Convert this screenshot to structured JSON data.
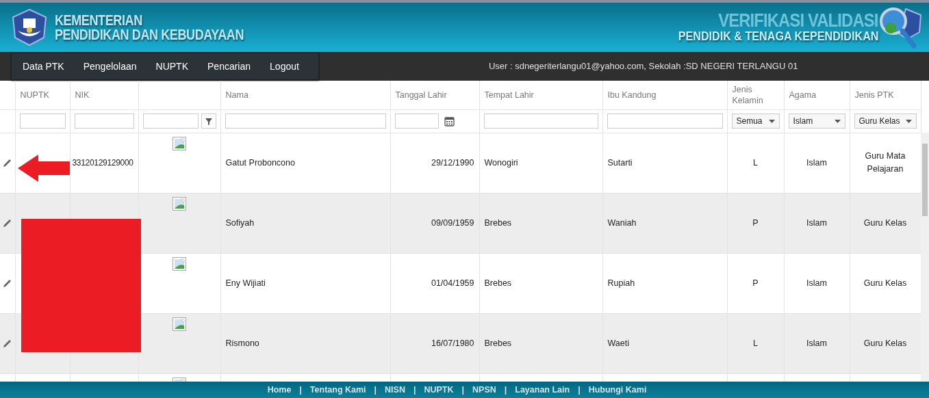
{
  "header": {
    "title_lines": [
      "KEMENTERIAN",
      "PENDIDIKAN DAN KEBUDAYAAN"
    ],
    "app_title": "VERIFIKASI VALIDASI",
    "app_subtitle": "PENDIDIK & TENAGA KEPENDIDIKAN"
  },
  "menu": [
    "Data PTK",
    "Pengelolaan",
    "NUPTK",
    "Pencarian",
    "Logout"
  ],
  "user_info": "User : sdnegeriterlangu01@yahoo.com, Sekolah :SD NEGERI TERLANGU 01",
  "table": {
    "columns": [
      {
        "label": "NUPTK",
        "filter": {
          "kind": "text"
        }
      },
      {
        "label": "NIK",
        "filter": {
          "kind": "text"
        }
      },
      {
        "filter": {
          "kind": "funnel"
        }
      },
      {
        "label": "Nama",
        "filter": {
          "kind": "text"
        }
      },
      {
        "label": "Tanggal Lahir",
        "filter": {
          "kind": "date"
        }
      },
      {
        "label": "Tempat Lahir",
        "filter": {
          "kind": "text"
        }
      },
      {
        "label": "Ibu Kandung",
        "filter": {
          "kind": "text"
        }
      },
      {
        "label": "Jenis Kelamin",
        "filter": {
          "kind": "select",
          "value": "Semua"
        }
      },
      {
        "label": "Agama",
        "filter": {
          "kind": "select",
          "value": "Islam"
        }
      },
      {
        "label": "Jenis PTK",
        "filter": {
          "kind": "select",
          "value": "Guru Kelas"
        }
      }
    ],
    "rows": [
      {
        "nik": "33120129129000",
        "nama": "Gatut Proboncono",
        "tanggal_lahir": "29/12/1990",
        "tempat_lahir": "Wonogiri",
        "ibu_kandung": "Sutarti",
        "jenis_kelamin": "L",
        "agama": "Islam",
        "jenis_ptk": "Guru Mata Pelajaran"
      },
      {
        "nama": "Sofiyah",
        "tanggal_lahir": "09/09/1959",
        "tempat_lahir": "Brebes",
        "ibu_kandung": "Waniah",
        "jenis_kelamin": "P",
        "agama": "Islam",
        "jenis_ptk": "Guru Kelas"
      },
      {
        "nama": "Eny Wijiati",
        "tanggal_lahir": "01/04/1959",
        "tempat_lahir": "Brebes",
        "ibu_kandung": "Rupiah",
        "jenis_kelamin": "P",
        "agama": "Islam",
        "jenis_ptk": "Guru Kelas"
      },
      {
        "nama": "Rismono",
        "tanggal_lahir": "16/07/1980",
        "tempat_lahir": "Brebes",
        "ibu_kandung": "Waeti",
        "jenis_kelamin": "L",
        "agama": "Islam",
        "jenis_ptk": "Guru Kelas"
      },
      {}
    ]
  },
  "footer": {
    "links": [
      "Home",
      "Tentang Kami",
      "NISN",
      "NUPTK",
      "NPSN",
      "Layanan Lain",
      "Hubungi Kami"
    ],
    "separator": "|"
  }
}
